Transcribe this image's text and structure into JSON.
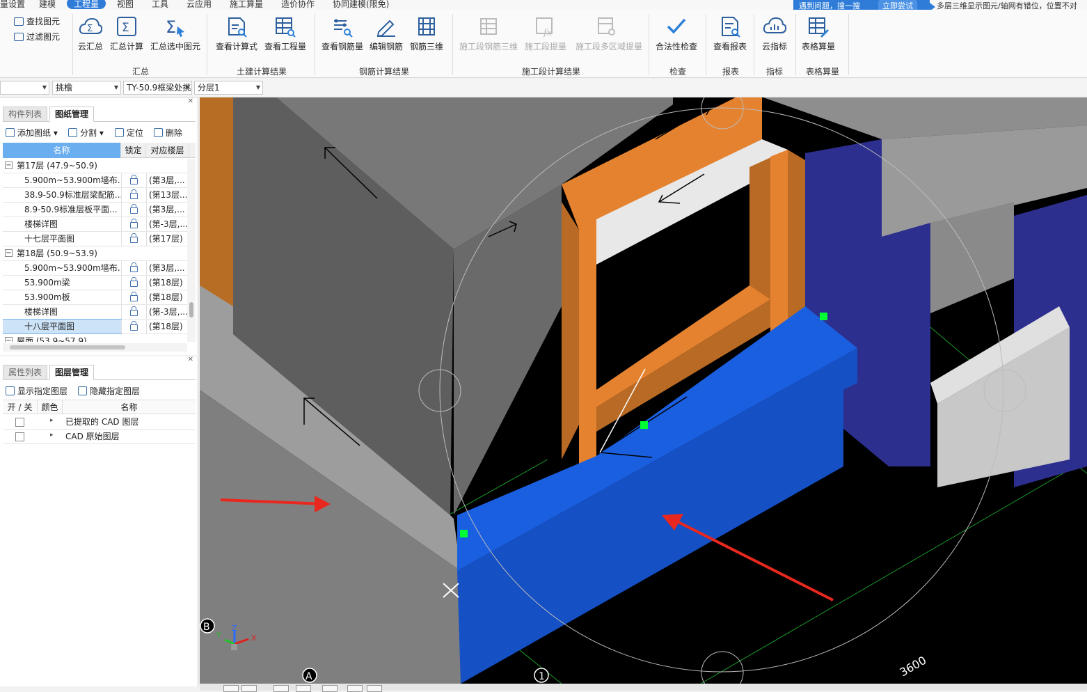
{
  "menu": [
    {
      "label": "量设置",
      "active": false
    },
    {
      "label": "建模",
      "active": false
    },
    {
      "label": "工程量",
      "active": true
    },
    {
      "label": "视图",
      "active": false
    },
    {
      "label": "工具",
      "active": false
    },
    {
      "label": "云应用",
      "active": false
    },
    {
      "label": "施工算量",
      "active": false
    },
    {
      "label": "造价协作",
      "active": false
    },
    {
      "label": "协同建模(限免)",
      "active": false
    }
  ],
  "help_banner": {
    "text": "遇到问题，搜一搜",
    "button": "立即尝试"
  },
  "help_query": "多层三维显示图元/轴网有错位，位置不对",
  "ribbon": {
    "small_buttons": [
      "查找图元",
      "过滤图元"
    ],
    "groups": [
      {
        "label": "汇总",
        "buttons": [
          "云汇总",
          "汇总计算",
          "汇总选中图元"
        ]
      },
      {
        "label": "土建计算结果",
        "buttons": [
          "查看计算式",
          "查看工程量"
        ]
      },
      {
        "label": "钢筋计算结果",
        "buttons": [
          "查看钢筋量",
          "编辑钢筋",
          "钢筋三维"
        ]
      },
      {
        "label": "施工段计算结果",
        "buttons": [
          "施工段钢筋三维",
          "施工段提量",
          "施工段多区域提量"
        ]
      },
      {
        "label": "检查",
        "buttons": [
          "合法性检查"
        ]
      },
      {
        "label": "报表",
        "buttons": [
          "查看报表"
        ]
      },
      {
        "label": "指标",
        "buttons": [
          "云指标"
        ]
      },
      {
        "label": "表格算量",
        "buttons": [
          "表格算量"
        ]
      }
    ]
  },
  "selectors": [
    "",
    "挑檐",
    "TY-50.9框梁处挑",
    "分层1"
  ],
  "drawing_panel": {
    "tabs": [
      "构件列表",
      "图纸管理"
    ],
    "active_tab": "图纸管理",
    "toolbar": [
      "添加图纸",
      "分割",
      "定位",
      "删除"
    ],
    "columns": [
      "名称",
      "锁定",
      "对应楼层"
    ],
    "rows": [
      {
        "type": "group",
        "name": "第17层 (47.9~50.9)",
        "expander": "−"
      },
      {
        "type": "item",
        "name": "5.900m~53.900m墙布...",
        "floor": "(第3层,..."
      },
      {
        "type": "item",
        "name": "38.9-50.9标准层梁配筋...",
        "floor": "(第13层..."
      },
      {
        "type": "item",
        "name": "8.9-50.9标准层板平面...",
        "floor": "(第3层,..."
      },
      {
        "type": "item",
        "name": "楼梯详图",
        "floor": "(第-3层,..."
      },
      {
        "type": "item",
        "name": "十七层平面图",
        "floor": "(第17层)"
      },
      {
        "type": "group",
        "name": "第18层 (50.9~53.9)",
        "expander": "−"
      },
      {
        "type": "item",
        "name": "5.900m~53.900m墙布...",
        "floor": "(第3层,..."
      },
      {
        "type": "item",
        "name": "53.900m梁",
        "floor": "(第18层)"
      },
      {
        "type": "item",
        "name": "53.900m板",
        "floor": "(第18层)"
      },
      {
        "type": "item",
        "name": "楼梯详图",
        "floor": "(第-3层,..."
      },
      {
        "type": "item",
        "name": "十八层平面图",
        "floor": "(第18层)",
        "selected": true
      },
      {
        "type": "group",
        "name": "屋面 (53.9~57.9)",
        "expander": "−"
      }
    ]
  },
  "layer_panel": {
    "tabs": [
      "属性列表",
      "图层管理"
    ],
    "active_tab": "图层管理",
    "toolbar": [
      "显示指定图层",
      "隐藏指定图层"
    ],
    "columns": [
      "开 / 关",
      "颜色",
      "名称"
    ],
    "rows": [
      "已提取的 CAD 图层",
      "CAD 原始图层"
    ]
  },
  "viewport": {
    "axis_labels": [
      "B",
      "A",
      "1"
    ],
    "dimension": "3600",
    "gizmo": {
      "x": "X",
      "y": "Y",
      "z": "Z"
    },
    "colors": {
      "background": "#000000",
      "beam_orange": "#e5822f",
      "slab_blue": "#1a5fe0",
      "wall_gray": "#6d6d6d",
      "column_navy": "#2d2f8f",
      "arrow_red": "#e8281e",
      "grip_green": "#00ff33"
    }
  }
}
